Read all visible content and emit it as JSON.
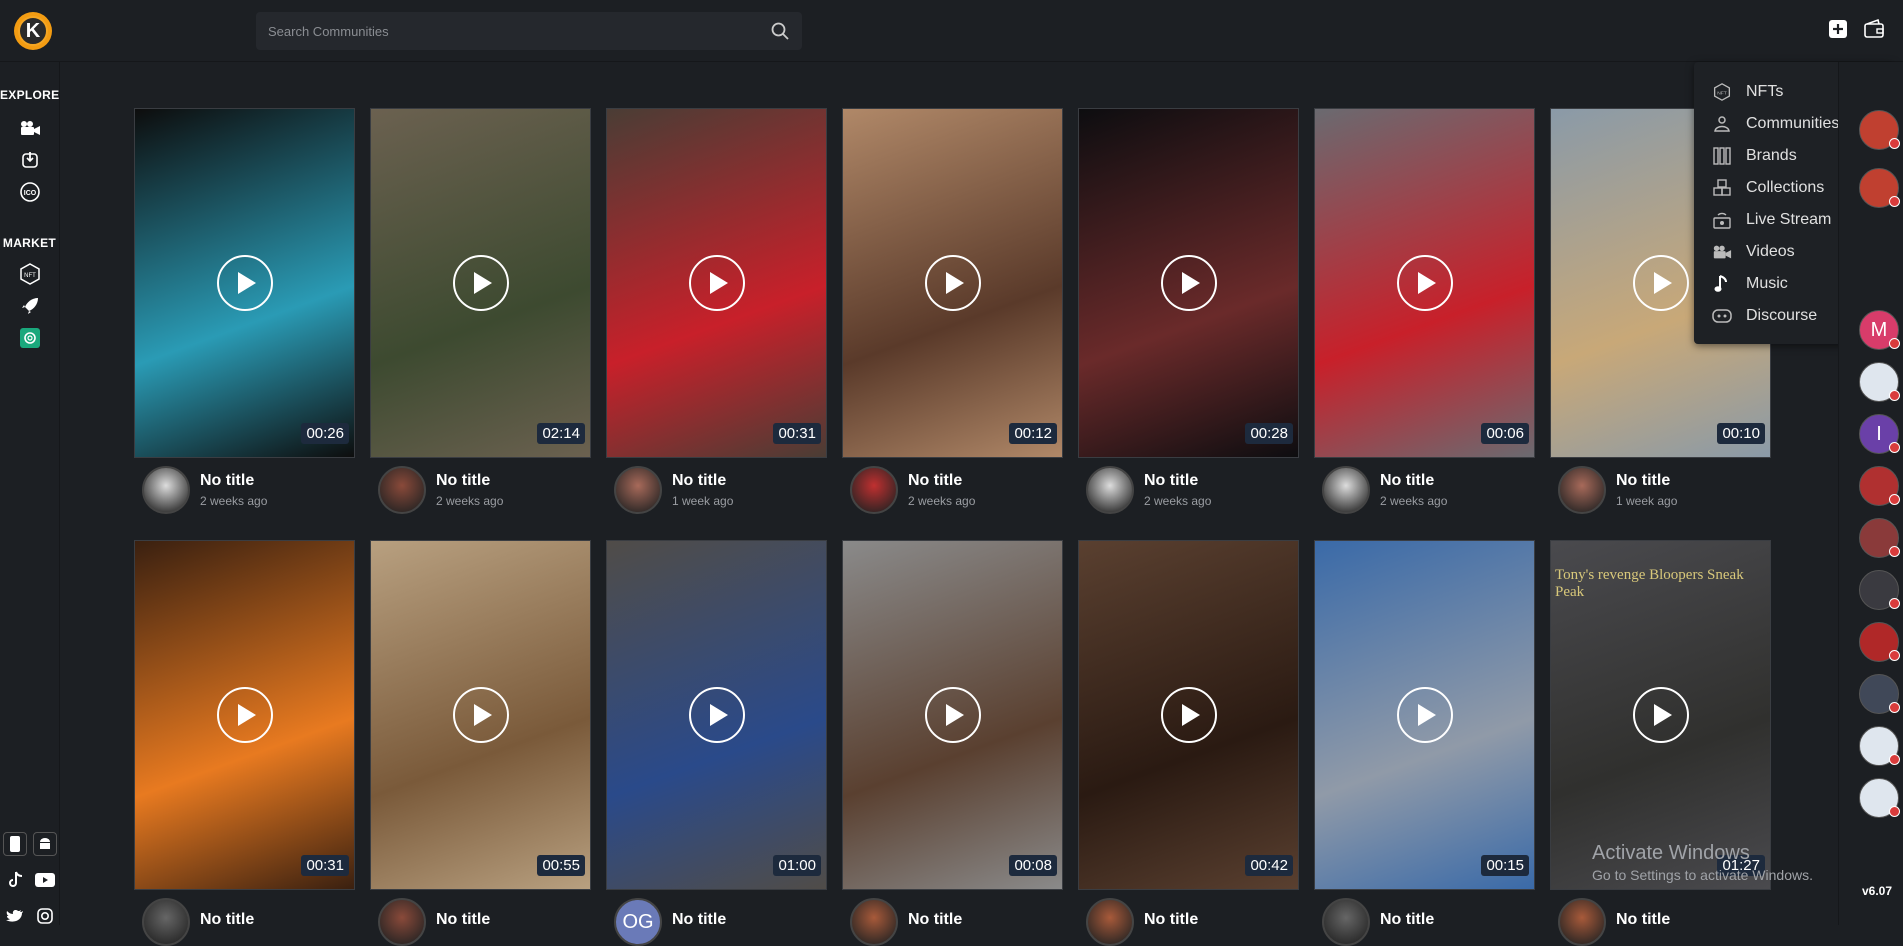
{
  "app": {
    "logo_letter": "K",
    "version": "v6.07"
  },
  "search": {
    "placeholder": "Search Communities"
  },
  "sidebar": {
    "explore_title": "EXPLORE",
    "market_title": "MARKET",
    "explore_items": [
      "video-camera-icon",
      "power-icon",
      "ico-icon"
    ],
    "market_items": [
      "nft-icon",
      "rocket-icon",
      "openai-icon"
    ]
  },
  "dropdown": {
    "items": [
      {
        "label": "NFTs",
        "icon": "nft-icon"
      },
      {
        "label": "Communities",
        "icon": "communities-icon"
      },
      {
        "label": "Brands",
        "icon": "brands-icon"
      },
      {
        "label": "Collections",
        "icon": "collections-icon"
      },
      {
        "label": "Live Stream",
        "icon": "live-stream-icon"
      },
      {
        "label": "Videos",
        "icon": "video-camera-icon"
      },
      {
        "label": "Music",
        "icon": "music-note-icon"
      },
      {
        "label": "Discourse",
        "icon": "discourse-icon"
      }
    ]
  },
  "videos_row1": [
    {
      "title": "No title",
      "ago": "2 weeks ago",
      "duration": "00:26",
      "bg": "#0d0d0d",
      "accent": "#2a9bb5",
      "avatar": "#ddd"
    },
    {
      "title": "No title",
      "ago": "2 weeks ago",
      "duration": "02:14",
      "bg": "#6b6150",
      "accent": "#3d4a30",
      "avatar": "#8a4a3a"
    },
    {
      "title": "No title",
      "ago": "1 week ago",
      "duration": "00:31",
      "bg": "#4a3d35",
      "accent": "#c8202a",
      "avatar": "#a86a5a"
    },
    {
      "title": "No title",
      "ago": "2 weeks ago",
      "duration": "00:12",
      "bg": "#b08868",
      "accent": "#5a3a2a",
      "avatar": "#c03030"
    },
    {
      "title": "No title",
      "ago": "2 weeks ago",
      "duration": "00:28",
      "bg": "#0d0d10",
      "accent": "#6a2a2a",
      "avatar": "#ddd"
    },
    {
      "title": "No title",
      "ago": "2 weeks ago",
      "duration": "00:06",
      "bg": "#6a6a70",
      "accent": "#c8202a",
      "avatar": "#ddd"
    },
    {
      "title": "No title",
      "ago": "1 week ago",
      "duration": "00:10",
      "bg": "#8a9aa8",
      "accent": "#c8a878",
      "avatar": "#a86a5a"
    }
  ],
  "videos_row2": [
    {
      "title": "No title",
      "ago": "",
      "duration": "00:31",
      "bg": "#3a2010",
      "accent": "#e87a20",
      "avatar": "#666"
    },
    {
      "title": "No title",
      "ago": "",
      "duration": "00:55",
      "bg": "#b8a080",
      "accent": "#7a5a3a",
      "avatar": "#8a4a3a"
    },
    {
      "title": "No title",
      "ago": "",
      "duration": "01:00",
      "bg": "#504c48",
      "accent": "#2a4a8a",
      "avatar": "#6a7ab8",
      "avatar_text": "OG"
    },
    {
      "title": "No title",
      "ago": "",
      "duration": "00:08",
      "bg": "#8a8a8a",
      "accent": "#5a4030",
      "avatar": "#a85a3a"
    },
    {
      "title": "No title",
      "ago": "",
      "duration": "00:42",
      "bg": "#5a4030",
      "accent": "#2a1a12",
      "avatar": "#a85a3a"
    },
    {
      "title": "No title",
      "ago": "",
      "duration": "00:15",
      "bg": "#3a6aa8",
      "accent": "#909aa8",
      "avatar": "#666"
    },
    {
      "title": "No title",
      "ago": "",
      "duration": "01:27",
      "bg": "#4a4a4e",
      "accent": "#30302e",
      "avatar": "#a85a3a"
    }
  ],
  "row2_caption_text": "Tony's revenge Bloopers Sneak Peak",
  "right_avatars": [
    {
      "color": "#c04030",
      "text": ""
    },
    {
      "color": "#c04030",
      "text": ""
    },
    {
      "color": "#d83c6a",
      "text": "M"
    },
    {
      "color": "#dfe6ee",
      "text": ""
    },
    {
      "color": "#6a40a8",
      "text": "I"
    },
    {
      "color": "#b03030",
      "text": ""
    },
    {
      "color": "#8a3a3a",
      "text": ""
    },
    {
      "color": "#3a3a40",
      "text": ""
    },
    {
      "color": "#b02828",
      "text": ""
    },
    {
      "color": "#404858",
      "text": ""
    },
    {
      "color": "#dfe6ee",
      "text": ""
    },
    {
      "color": "#dfe6ee",
      "text": ""
    }
  ],
  "watermark": {
    "line1": "Activate Windows",
    "line2": "Go to Settings to activate Windows."
  },
  "colors": {
    "bg": "#1c1f23",
    "logo": "#f39c12",
    "badge": "#d93c3c",
    "duration_bg": "#1d2a3d"
  }
}
